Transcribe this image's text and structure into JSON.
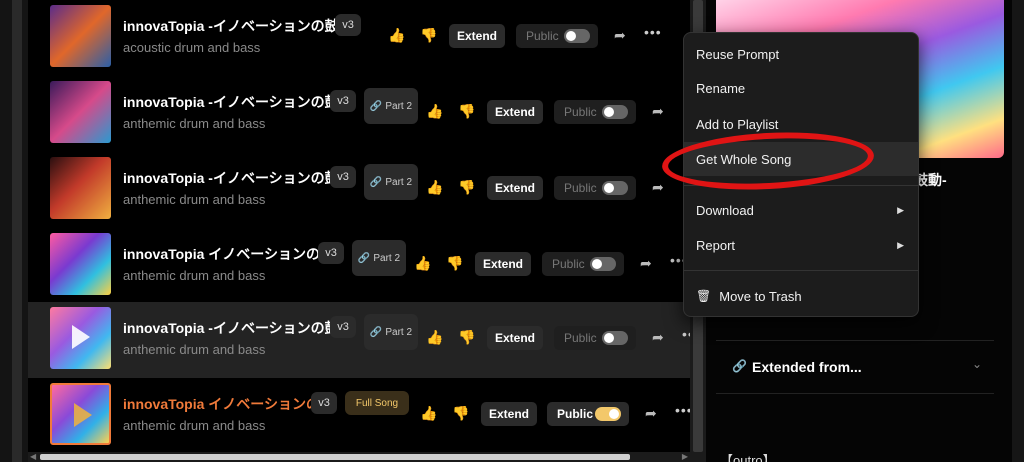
{
  "songs": [
    {
      "title": "innovaTopia -イノベーションの鼓動-",
      "style": "acoustic drum and bass",
      "version": "v3",
      "extend": "Extend",
      "visibility": "Public",
      "public_on": false
    },
    {
      "title": "innovaTopia -イノベーションの鼓...",
      "style": "anthemic drum and bass",
      "version": "v3",
      "part_label": "Part 2",
      "extend": "Extend",
      "visibility": "Public",
      "public_on": false
    },
    {
      "title": "innovaTopia -イノベーションの鼓...",
      "style": "anthemic drum and bass",
      "version": "v3",
      "part_label": "Part 2",
      "extend": "Extend",
      "visibility": "Public",
      "public_on": false
    },
    {
      "title": "innovaTopia イノベーションの...",
      "style": "anthemic drum and bass",
      "version": "v3",
      "part_label": "Part 2",
      "extend": "Extend",
      "visibility": "Public",
      "public_on": false
    },
    {
      "title": "innovaTopia -イノベーションの鼓...",
      "style": "anthemic drum and bass",
      "version": "v3",
      "part_label": "Part 2",
      "extend": "Extend",
      "visibility": "Public",
      "public_on": false
    },
    {
      "title": "innovaTopia イノベーションの...",
      "style": "anthemic drum and bass",
      "version": "v3",
      "badge": "Full Song",
      "extend": "Extend",
      "visibility": "Public",
      "public_on": true
    }
  ],
  "context_menu": {
    "items": [
      "Reuse Prompt",
      "Rename",
      "Add to Playlist",
      "Get Whole Song",
      "Download",
      "Report",
      "Move to Trash"
    ]
  },
  "right_panel": {
    "title_fragment": "鼓動-",
    "extended_from": "Extended from...",
    "lyrics_tag": "【outro】"
  },
  "colors": {
    "accent": "#f07a3a",
    "highlight_ring": "#e01414",
    "toggle_on": "#f3c86a"
  }
}
